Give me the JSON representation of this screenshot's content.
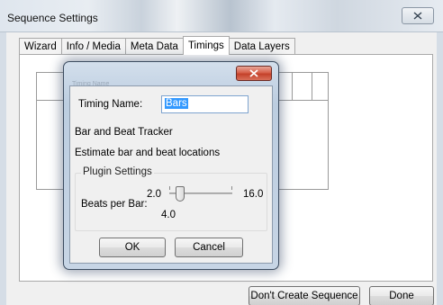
{
  "window": {
    "title": "Sequence Settings",
    "close_icon": "close-icon"
  },
  "tabs": [
    {
      "label": "Wizard",
      "active": false
    },
    {
      "label": "Info / Media",
      "active": false
    },
    {
      "label": "Meta Data",
      "active": false
    },
    {
      "label": "Timings",
      "active": true
    },
    {
      "label": "Data Layers",
      "active": false
    }
  ],
  "footer": {
    "dont_create_label": "Don't Create Sequence",
    "done_label": "Done"
  },
  "dialog": {
    "caption": "Timing Name",
    "timing_name_label": "Timing Name:",
    "timing_name_value": "Bars",
    "plugin_name": "Bar and Beat Tracker",
    "plugin_description": "Estimate bar and beat locations",
    "plugin_settings_title": "Plugin Settings",
    "beats_per_bar_label": "Beats per Bar:",
    "slider": {
      "min_label": "2.0",
      "max_label": "16.0",
      "value_label": "4.0",
      "min": 2.0,
      "max": 16.0,
      "value": 4.0
    },
    "ok_label": "OK",
    "cancel_label": "Cancel"
  },
  "colors": {
    "selection": "#3399ff",
    "close_button": "#c4412a"
  }
}
